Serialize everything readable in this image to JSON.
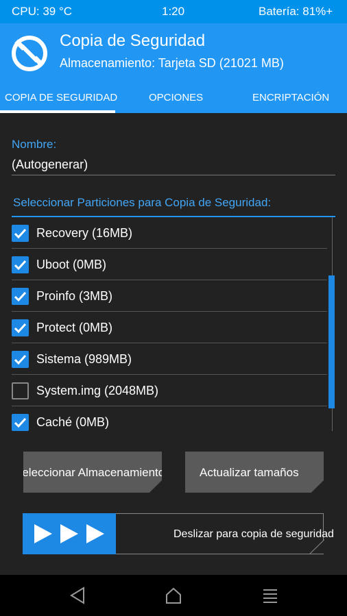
{
  "status": {
    "cpu": "CPU: 39 °C",
    "time": "1:20",
    "battery": "Batería: 81%+"
  },
  "header": {
    "title": "Copia de Seguridad",
    "subtitle": "Almacenamiento: Tarjeta SD (21021 MB)"
  },
  "tabs": [
    {
      "label": "COPIA DE SEGURIDAD",
      "active": true
    },
    {
      "label": "OPCIONES"
    },
    {
      "label": "ENCRIPTACIÓN"
    }
  ],
  "name": {
    "label": "Nombre:",
    "value": "(Autogenerar)"
  },
  "partitions": {
    "label": "Seleccionar Particiones para Copia de Seguridad:",
    "items": [
      {
        "label": "Recovery (16MB)",
        "checked": true
      },
      {
        "label": "Uboot (0MB)",
        "checked": true
      },
      {
        "label": "Proinfo (3MB)",
        "checked": true
      },
      {
        "label": "Protect (0MB)",
        "checked": true
      },
      {
        "label": "Sistema (989MB)",
        "checked": true
      },
      {
        "label": "System.img (2048MB)",
        "checked": false
      },
      {
        "label": "Caché (0MB)",
        "checked": true
      }
    ]
  },
  "buttons": {
    "storage": "Seleccionar Almacenamiento",
    "refresh": "Actualizar tamaños"
  },
  "slider": {
    "label": "Deslizar para copia de seguridad"
  },
  "colors": {
    "accent": "#2196f3",
    "status_bar": "#0091ea",
    "background": "#222222",
    "button": "#5a5a5a"
  },
  "nav": {
    "icons": [
      "back-icon",
      "home-icon",
      "menu-icon"
    ]
  }
}
